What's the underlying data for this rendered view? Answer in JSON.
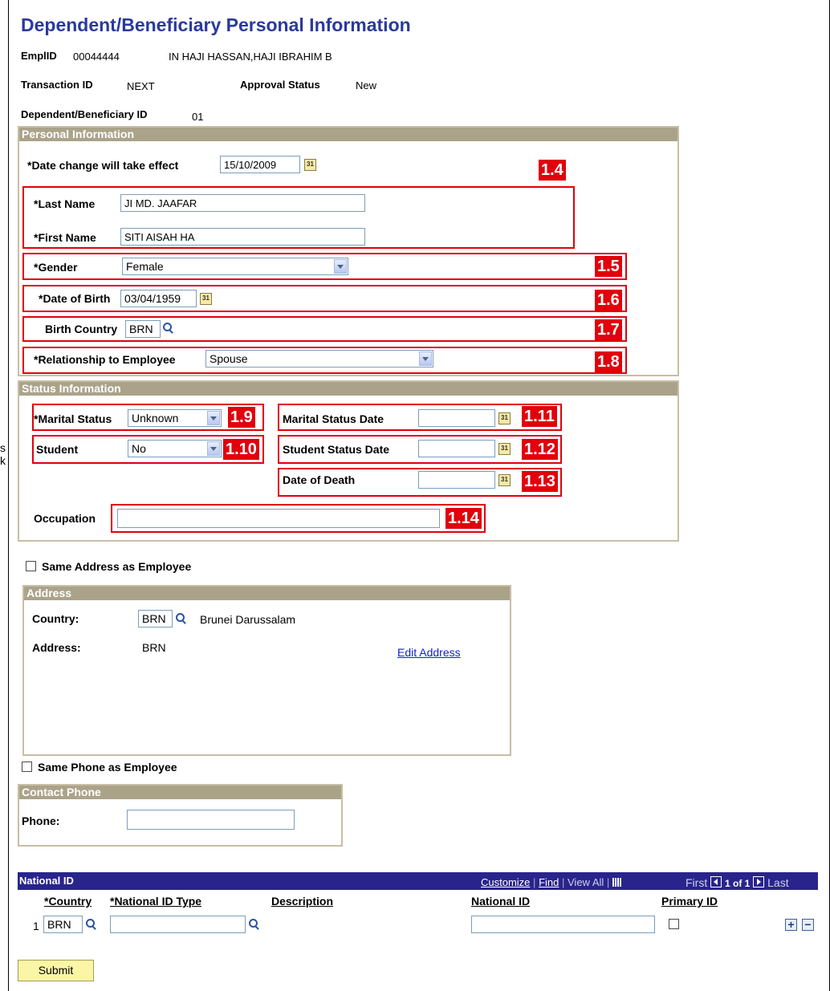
{
  "page_title": "Dependent/Beneficiary Personal Information",
  "header": {
    "emplid_label": "EmplID",
    "emplid_value": "00044444",
    "employee_name": "IN HAJI HASSAN,HAJI IBRAHIM B",
    "transaction_id_label": "Transaction ID",
    "transaction_id_value": "NEXT",
    "approval_status_label": "Approval Status",
    "approval_status_value": "New",
    "dependent_id_label": "Dependent/Beneficiary ID",
    "dependent_id_value": "01"
  },
  "left_edge_text": [
    "s",
    "k"
  ],
  "personal": {
    "section_title": "Personal Information",
    "date_change_label": "*Date change will take effect",
    "date_change_value": "15/10/2009",
    "last_name_label": "*Last Name",
    "last_name_value": "JI MD. JAAFAR",
    "first_name_label": "*First Name",
    "first_name_value": "SITI AISAH HA",
    "gender_label": "*Gender",
    "gender_value": "Female",
    "dob_label": "*Date of Birth",
    "dob_value": "03/04/1959",
    "birth_country_label": "Birth Country",
    "birth_country_value": "BRN",
    "relationship_label": "*Relationship to Employee",
    "relationship_value": "Spouse"
  },
  "status": {
    "section_title": "Status Information",
    "marital_status_label": "*Marital Status",
    "marital_status_value": "Unknown",
    "student_label": "Student",
    "student_value": "No",
    "marital_status_date_label": "Marital Status Date",
    "marital_status_date_value": "",
    "student_status_date_label": "Student Status Date",
    "student_status_date_value": "",
    "date_of_death_label": "Date of Death",
    "date_of_death_value": "",
    "occupation_label": "Occupation",
    "occupation_value": ""
  },
  "annotations": {
    "a14": "1.4",
    "a15": "1.5",
    "a16": "1.6",
    "a17": "1.7",
    "a18": "1.8",
    "a19": "1.9",
    "a110": "1.10",
    "a111": "1.11",
    "a112": "1.12",
    "a113": "1.13",
    "a114": "1.14"
  },
  "same_address_label": "Same Address as Employee",
  "address": {
    "section_title": "Address",
    "country_label": "Country:",
    "country_value": "BRN",
    "country_name": "Brunei Darussalam",
    "address_label": "Address:",
    "address_value": "BRN",
    "edit_link": "Edit Address"
  },
  "same_phone_label": "Same Phone as Employee",
  "contact_phone": {
    "section_title": "Contact Phone",
    "phone_label": "Phone:",
    "phone_value": ""
  },
  "national_id": {
    "title": "National ID",
    "customize": "Customize",
    "find": "Find",
    "view_all": "View All",
    "first": "First",
    "count": "1 of 1",
    "last": "Last",
    "col_country": "*Country",
    "col_type": "*National ID Type",
    "col_description": "Description",
    "col_national_id": "National ID",
    "col_primary": "Primary ID",
    "row_num": "1",
    "row_country": "BRN",
    "row_type": "",
    "row_national_id": ""
  },
  "submit_label": "Submit",
  "colors": {
    "title": "#2a3a9c",
    "section_header": "#aba389",
    "annotation_red": "#e1000b",
    "grid_header": "#29248c",
    "submit_bg": "#fbf5a6"
  }
}
